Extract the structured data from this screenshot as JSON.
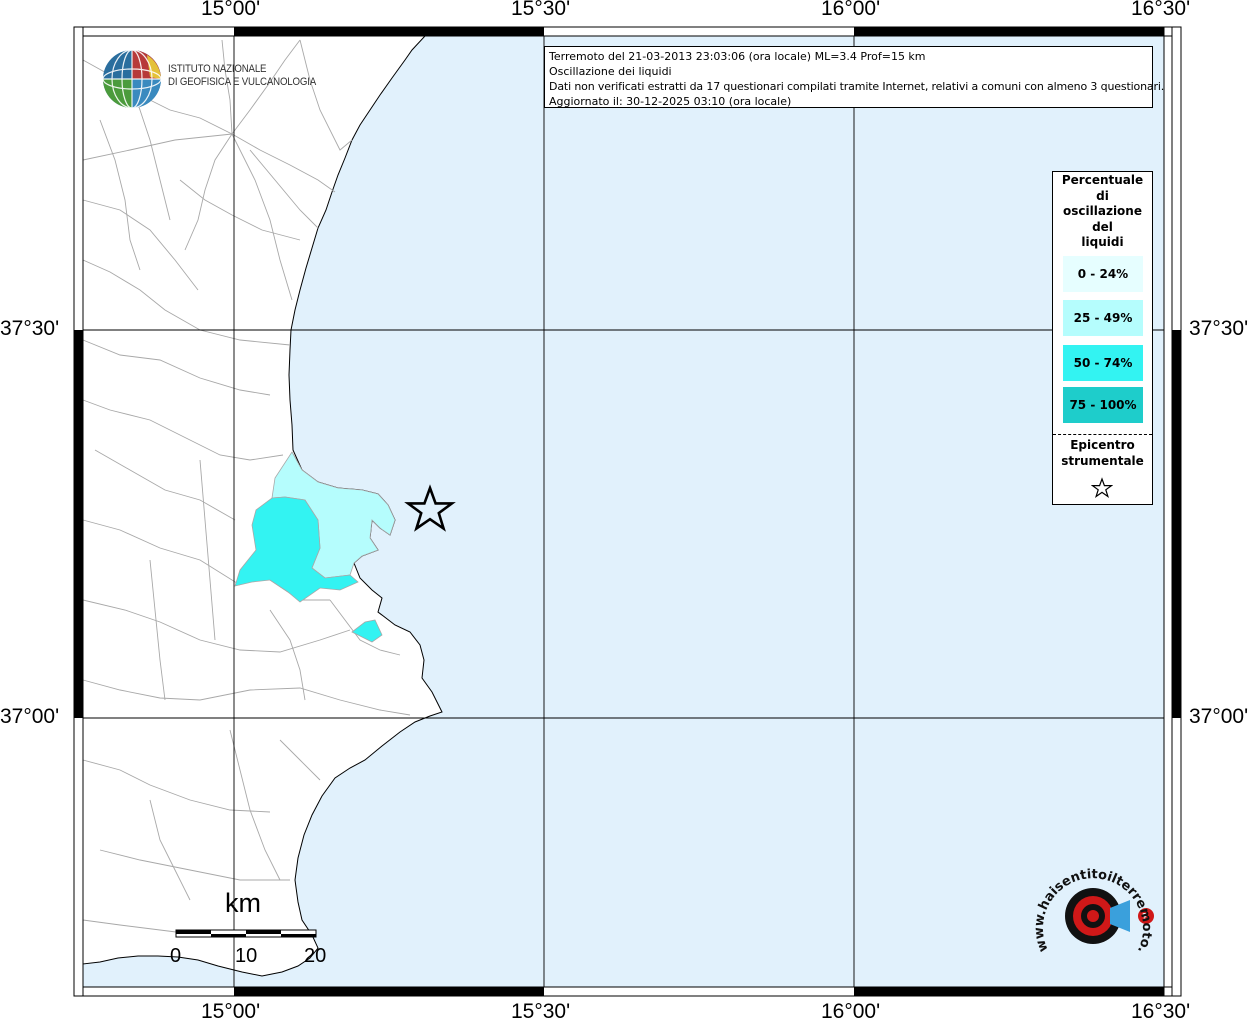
{
  "info": {
    "line1": "Terremoto del 21-03-2013 23:03:06 (ora locale) ML=3.4 Prof=15 km",
    "line2": "Oscillazione dei liquidi",
    "line3": "Dati non verificati estratti da 17 questionari compilati tramite Internet, relativi a comuni con almeno 3 questionari.",
    "line4": "Aggiornato il: 30-12-2025 03:10 (ora locale)"
  },
  "axes": {
    "top": [
      "15°00'",
      "15°30'",
      "16°00'",
      "16°30'"
    ],
    "bottom": [
      "15°00'",
      "15°30'",
      "16°00'",
      "16°30'"
    ],
    "left": [
      "37°30'",
      "37°00'"
    ],
    "right": [
      "37°30'",
      "37°00'"
    ]
  },
  "legend": {
    "title": [
      "Percentuale",
      "di",
      "oscillazione",
      "del",
      "liquidi"
    ],
    "classes": [
      {
        "label": "0 - 24%",
        "color": "#e6feff"
      },
      {
        "label": "25 - 49%",
        "color": "#b5fdfd"
      },
      {
        "label": "50 - 74%",
        "color": "#33f3f2"
      },
      {
        "label": "75 - 100%",
        "color": "#1ecdcb"
      }
    ],
    "epicenter_label": [
      "Epicentro",
      "strumentale"
    ],
    "epicenter_icon": "star-outline-icon"
  },
  "logo": {
    "ingv_line1": "ISTITUTO NAZIONALE",
    "ingv_line2": "DI GEOFISICA E VULCANOLOGIA",
    "hst_text": "www.haisentitoilterremoto.it"
  },
  "scale": {
    "title": "km",
    "labels": [
      "0",
      "10",
      "20"
    ]
  },
  "colors": {
    "sea": "#e1f1fc",
    "land": "#ffffff",
    "borders": "#a8a8a8",
    "grid": "#000000"
  }
}
